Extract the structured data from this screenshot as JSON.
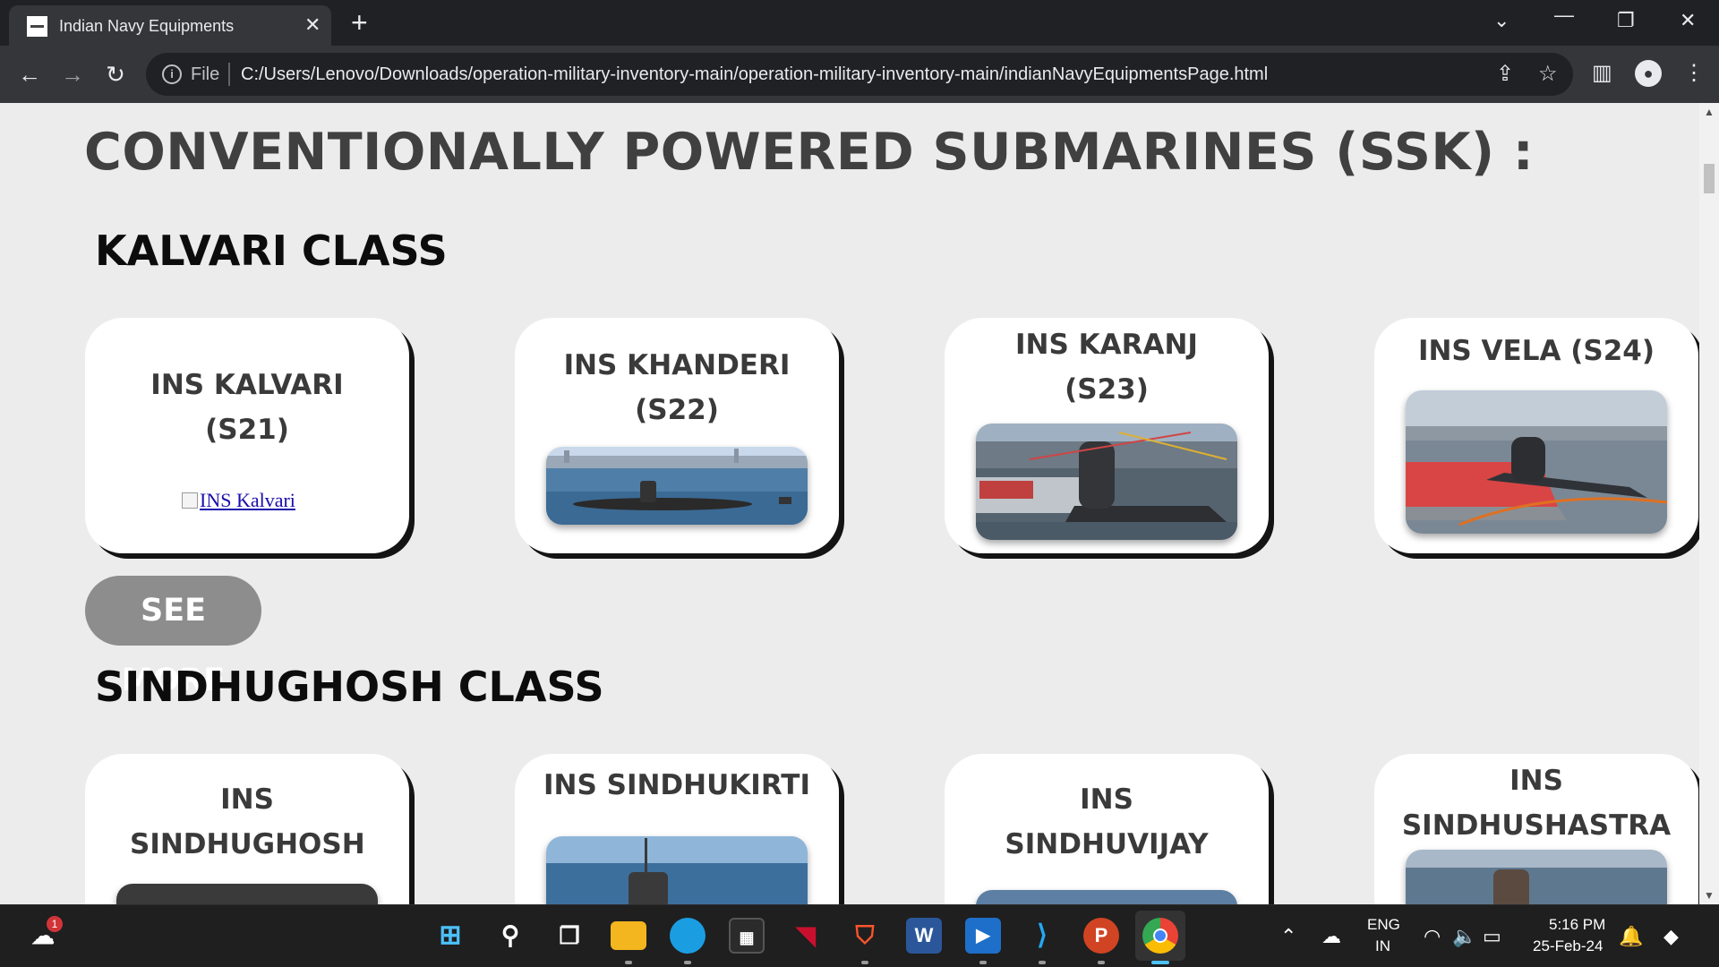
{
  "browser": {
    "tab_title": "Indian Navy Equipments",
    "tab_close": "✕",
    "new_tab": "+",
    "file_label": "File",
    "url": "C:/Users/Lenovo/Downloads/operation-military-inventory-main/operation-military-inventory-main/indianNavyEquipmentsPage.html",
    "icons": [
      "back-icon",
      "forward-icon",
      "reload-icon",
      "info-icon",
      "share-icon",
      "star-icon",
      "side-panel-icon",
      "profile-icon",
      "menu-icon"
    ]
  },
  "page": {
    "heading": "CONVENTIONALLY POWERED SUBMARINES (SSK) :",
    "sections": [
      {
        "title": "KALVARI CLASS",
        "cards": [
          {
            "title": "INS KALVARI (S21)",
            "image_alt": "INS Kalvari"
          },
          {
            "title": "INS KHANDERI (S22)"
          },
          {
            "title": "INS KARANJ (S23)"
          },
          {
            "title": "INS VELA (S24)"
          }
        ],
        "see_more": "SEE MORE"
      },
      {
        "title": "SINDHUGHOSH CLASS",
        "cards": [
          {
            "title": "INS SINDHUGHOSH"
          },
          {
            "title": "INS SINDHUKIRTI"
          },
          {
            "title": "INS SINDHUVIJAY"
          },
          {
            "title": "INS SINDHUSHASTRA"
          }
        ]
      }
    ]
  },
  "taskbar": {
    "weather_badge": "1",
    "language": "ENG",
    "region": "IN",
    "time": "5:16 PM",
    "date": "25-Feb-24",
    "apps": [
      "windows-start-icon",
      "search-icon",
      "task-view-icon",
      "file-explorer-icon",
      "edge-icon",
      "store-icon",
      "mcafee-icon",
      "brave-icon",
      "word-icon",
      "media-player-icon",
      "vscode-icon",
      "powerpoint-icon",
      "chrome-icon"
    ],
    "word_letter": "W",
    "powerpoint_letter": "P"
  }
}
